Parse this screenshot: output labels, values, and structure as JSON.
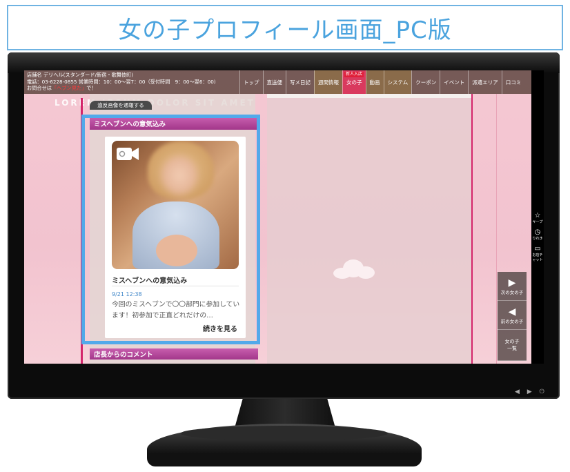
{
  "page_title": "女の子プロフィール画面_PC版",
  "header": {
    "shop_name_line": "店舗名 デリヘル(スタンダード/新宿・歌舞伎町)",
    "phone_line": "電話：03-6228-0855 営業時間：10：00〜翌7：00（受付時間　9：00〜翌6：00)",
    "inquiry_prefix": "お問合せは",
    "inquiry_highlight": "「ヘブン見た」",
    "inquiry_suffix": "で！"
  },
  "nav": {
    "new_badge": "新人入店",
    "items": [
      "トップ",
      "直送便",
      "写メ日記",
      "週間情報",
      "女の子",
      "動画",
      "システム",
      "クーポン",
      "イベント",
      "派遣エリア",
      "口コミ"
    ]
  },
  "banner_text": "LOREM IPSUM DOLOR SIT AMET",
  "report_button": "違反画像を通報する",
  "section": {
    "heading": "ミスヘブンへの意気込み",
    "card": {
      "title": "ミスヘブンへの意気込み",
      "date": "9/21 12:38",
      "text": "今回のミスヘブンで〇〇部門に参加しています！初参加で正直どれだけの…",
      "more": "続きを見る"
    }
  },
  "section2_heading": "店長からのコメント",
  "side_icons": [
    {
      "icon": "star-icon",
      "label": "キープ"
    },
    {
      "icon": "clock-icon",
      "label": "りれき"
    },
    {
      "icon": "chat-icon",
      "label": "お店チャット"
    }
  ],
  "side_nav": {
    "next": "次の女の子",
    "prev": "前の女の子",
    "list_line1": "女の子",
    "list_line2": "一覧"
  },
  "monitor_buttons": "◀ ▶ ⏻",
  "colors": {
    "title_text": "#4aa3de",
    "highlight_border": "#52a9ea",
    "section_head": "#b04a9c",
    "active_nav": "#d93a5e"
  }
}
